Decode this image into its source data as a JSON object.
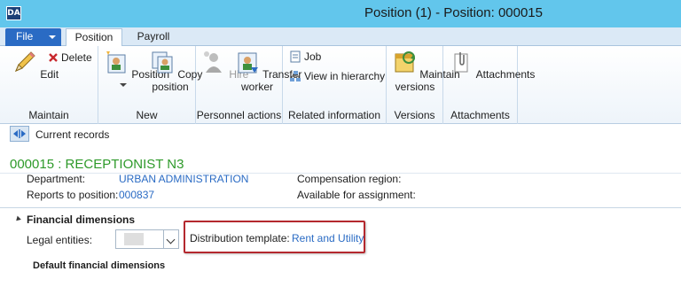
{
  "window": {
    "title": "Position (1) - Position: 000015",
    "app_icon_text": "DA"
  },
  "tabs": {
    "file_label": "File",
    "items": [
      {
        "label": "Position",
        "active": true
      },
      {
        "label": "Payroll",
        "active": false
      }
    ]
  },
  "ribbon": {
    "maintain": {
      "edit_label": "Edit",
      "delete_label": "Delete",
      "group_label": "Maintain"
    },
    "new": {
      "position_label": "Position",
      "copy_label_line1": "Copy",
      "copy_label_line2": "position",
      "group_label": "New"
    },
    "personnel": {
      "hire_label": "Hire",
      "transfer_label_line1": "Transfer",
      "transfer_label_line2": "worker",
      "group_label": "Personnel actions"
    },
    "related": {
      "job_label": "Job",
      "hierarchy_label": "View in hierarchy",
      "group_label": "Related information"
    },
    "versions": {
      "maintain_label_line1": "Maintain",
      "maintain_label_line2": "versions",
      "group_label": "Versions"
    },
    "attachments": {
      "attachments_label": "Attachments",
      "group_label": "Attachments"
    }
  },
  "records": {
    "label": "Current records"
  },
  "record": {
    "title": "000015 : RECEPTIONIST N3",
    "department_label": "Department:",
    "department_value": "URBAN ADMINISTRATION",
    "reports_to_label": "Reports to position:",
    "reports_to_value": "000837",
    "compensation_label": "Compensation region:",
    "available_label": "Available for assignment:"
  },
  "financial": {
    "section_title": "Financial dimensions",
    "legal_entities_label": "Legal entities:",
    "distribution_label": "Distribution template:",
    "distribution_value": "Rent and Utility",
    "default_dimensions_label": "Default financial dimensions"
  },
  "colors": {
    "title_bar": "#62c6ec",
    "file_tab": "#2a6bc4",
    "link": "#2a6bc4",
    "record_title": "#2e9a2a",
    "highlight": "#b4282e"
  }
}
